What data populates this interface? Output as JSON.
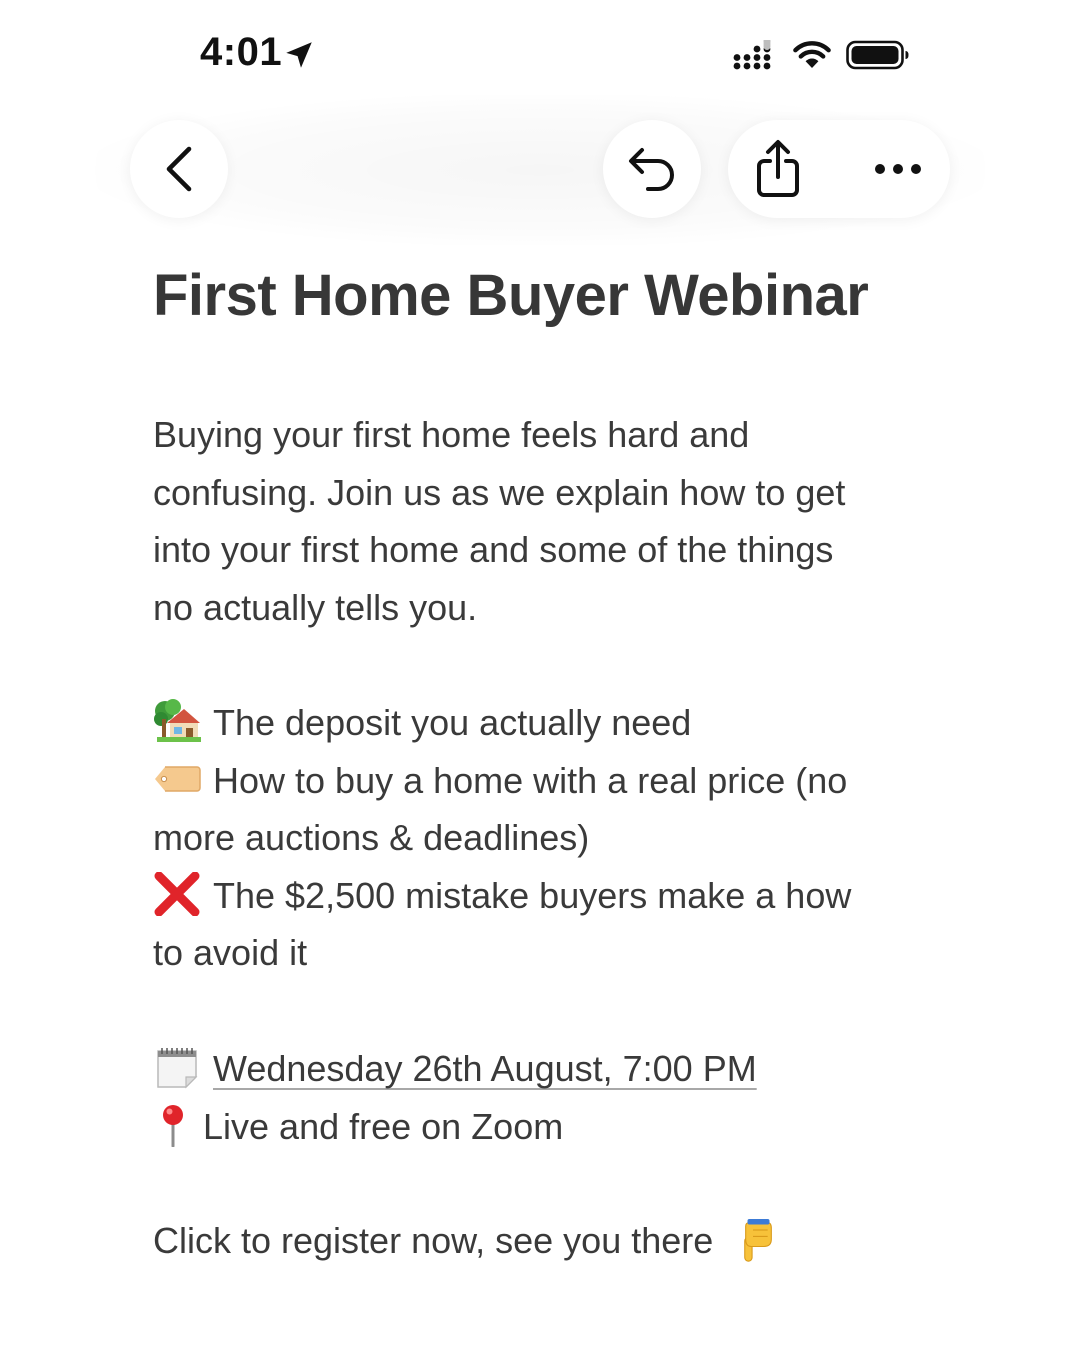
{
  "status_bar": {
    "time": "4:01"
  },
  "toolbar": {
    "icons": {
      "back": "chevron-left-icon",
      "undo": "undo-arrow-icon",
      "share": "share-icon",
      "more": "ellipsis-icon"
    }
  },
  "page": {
    "title": "First Home Buyer Webinar",
    "intro_lines": [
      "Buying your first home feels hard and",
      "confusing. Join us as we explain how to get",
      "into your first home and some of the things",
      "no actually tells you."
    ],
    "bullets": [
      {
        "icon": "house-with-garden-icon",
        "lines": [
          "The deposit you actually need"
        ]
      },
      {
        "icon": "price-tag-icon",
        "lines": [
          "How to buy a home with a real price (no",
          "more auctions & deadlines)"
        ]
      },
      {
        "icon": "red-cross-mark-icon",
        "lines": [
          "The $2,500 mistake buyers make a how",
          "to avoid it"
        ]
      }
    ],
    "event": {
      "date_icon": "calendar-icon",
      "date_text": "Wednesday 26th August, 7:00 PM",
      "location_icon": "round-pushpin-icon",
      "location_text": "Live and free on Zoom"
    },
    "cta": {
      "text": "Click to register now, see you there",
      "icon": "pointing-down-hand-icon"
    }
  },
  "colors": {
    "title": "#373737",
    "body": "#3a3a3a",
    "status": "#111111",
    "cross": "#e0242a"
  }
}
